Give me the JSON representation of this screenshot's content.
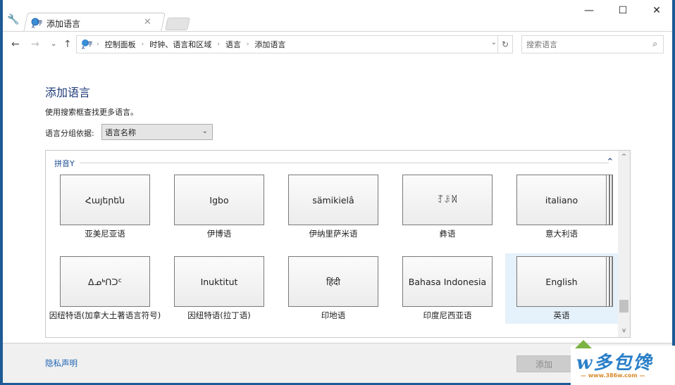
{
  "window": {
    "tab_title": "添加语言",
    "controls": {
      "minimize": "—",
      "maximize": "☐",
      "close": "✕"
    }
  },
  "nav": {
    "back": "←",
    "forward": "→",
    "recent": "⌄",
    "up": "↑",
    "breadcrumbs": [
      "控制面板",
      "时钟、语言和区域",
      "语言",
      "添加语言"
    ],
    "separator": "›",
    "dropdown": "⌄",
    "refresh": "↻",
    "search_placeholder": "搜索语言",
    "search_icon": "⚲"
  },
  "page": {
    "title": "添加语言",
    "hint": "使用搜索框查找更多语言。",
    "group_by_label": "语言分组依据:",
    "group_by_value": "语言名称",
    "section": "拼音Y",
    "collapse_icon": "⌃"
  },
  "languages": [
    {
      "native": "Հայերեն",
      "name": "亚美尼亚语",
      "stacked": false,
      "selected": false
    },
    {
      "native": "Igbo",
      "name": "伊博语",
      "stacked": false,
      "selected": false
    },
    {
      "native": "sämikielâ",
      "name": "伊纳里萨米语",
      "stacked": false,
      "selected": false
    },
    {
      "native": "ꆈꌠꉙ",
      "name": "彝语",
      "stacked": false,
      "selected": false
    },
    {
      "native": "italiano",
      "name": "意大利语",
      "stacked": true,
      "selected": false
    },
    {
      "native": "ᐃᓄᒃᑎᑐᑦ",
      "name": "因纽特语(加拿大土著语言符号)",
      "stacked": false,
      "selected": false
    },
    {
      "native": "Inuktitut",
      "name": "因纽特语(拉丁语)",
      "stacked": false,
      "selected": false
    },
    {
      "native": "हिंदी",
      "name": "印地语",
      "stacked": false,
      "selected": false
    },
    {
      "native": "Bahasa Indonesia",
      "name": "印度尼西亚语",
      "stacked": false,
      "selected": false
    },
    {
      "native": "English",
      "name": "英语",
      "stacked": true,
      "selected": true
    }
  ],
  "scrollbar": {
    "up": "⌃",
    "down": "⌄"
  },
  "footer": {
    "privacy": "隐私声明",
    "add_button": "添加"
  },
  "watermark": {
    "text": "w多包馋",
    "url": "— www.386w.com —"
  }
}
